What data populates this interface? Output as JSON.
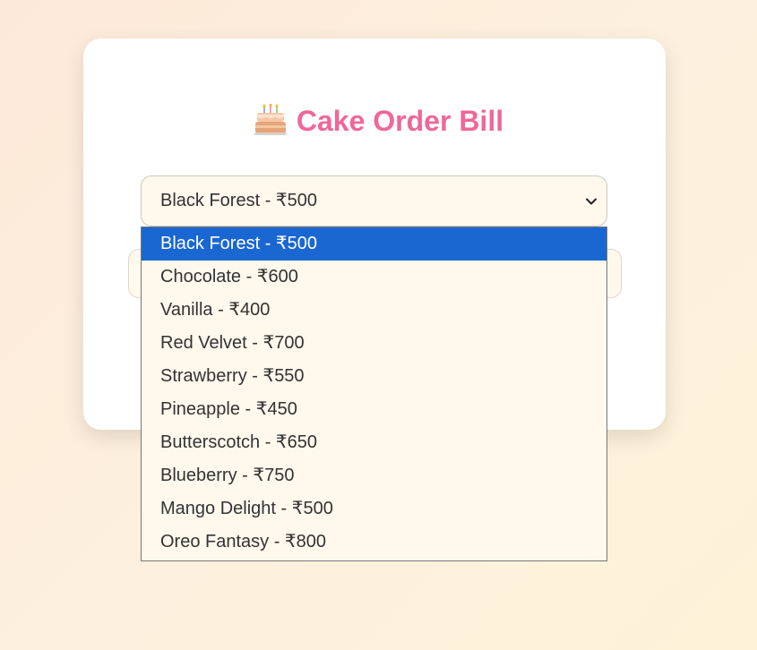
{
  "page": {
    "title": "Cake Order Bill",
    "title_icon": "cake-icon",
    "accent_color": "#f0679a"
  },
  "cake_select": {
    "selected_label": "Black Forest - ₹500",
    "highlight_color": "#1a67d2",
    "options": [
      {
        "label": "Black Forest - ₹500",
        "selected": true
      },
      {
        "label": "Chocolate - ₹600",
        "selected": false
      },
      {
        "label": "Vanilla - ₹400",
        "selected": false
      },
      {
        "label": "Red Velvet - ₹700",
        "selected": false
      },
      {
        "label": "Strawberry - ₹550",
        "selected": false
      },
      {
        "label": "Pineapple - ₹450",
        "selected": false
      },
      {
        "label": "Butterscotch - ₹650",
        "selected": false
      },
      {
        "label": "Blueberry - ₹750",
        "selected": false
      },
      {
        "label": "Mango Delight - ₹500",
        "selected": false
      },
      {
        "label": "Oreo Fantasy - ₹800",
        "selected": false
      }
    ]
  }
}
